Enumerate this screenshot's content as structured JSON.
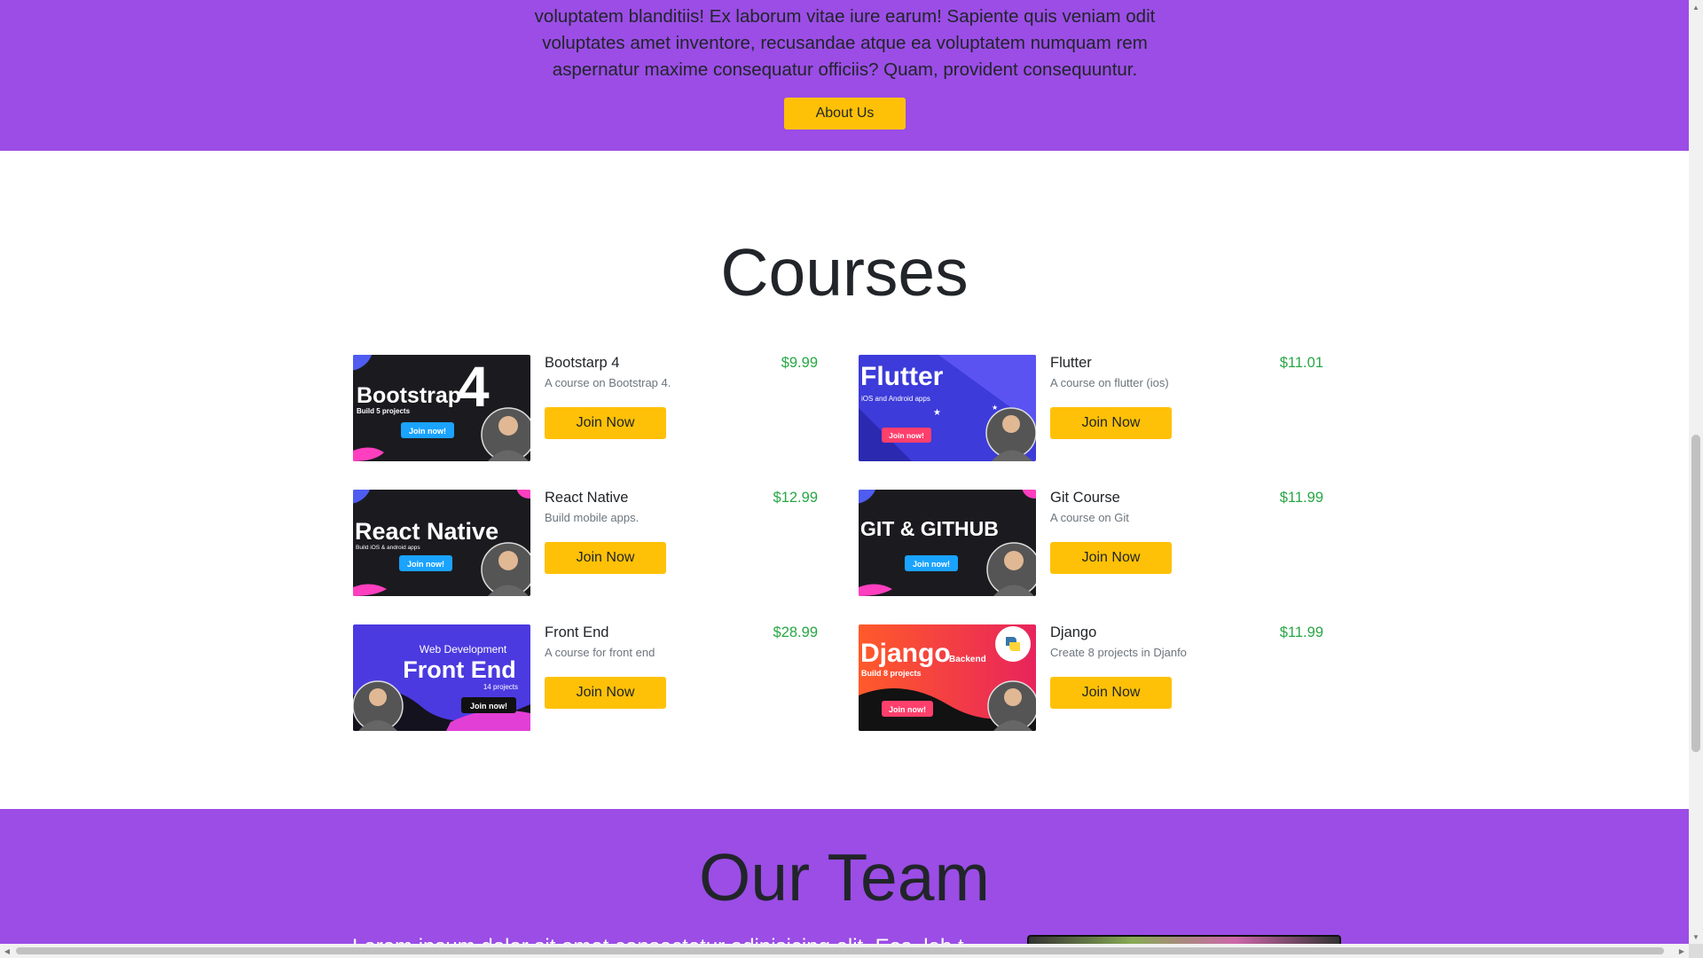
{
  "about": {
    "text": "voluptatem blanditiis! Ex laborum vitae iure earum! Sapiente quis veniam odit voluptates amet inventore, recusandae atque ea voluptatem numquam rem aspernatur maxime consequatur officiis? Quam, provident consequuntur.",
    "button_label": "About Us"
  },
  "courses": {
    "title": "Courses",
    "join_label": "Join Now",
    "items": [
      {
        "name": "Bootstarp 4",
        "description": "A course on Bootstrap 4.",
        "price": "$9.99",
        "thumb": {
          "title": "Bootstrap 4",
          "subtitle": "Build 5 projects",
          "badge": "Join now!",
          "bg": "#1b1b1f"
        }
      },
      {
        "name": "Flutter",
        "description": "A course on flutter (ios)",
        "price": "$11.01",
        "thumb": {
          "title": "Flutter",
          "subtitle": "iOS and Android apps",
          "badge": "Join now!",
          "bg": "#3d3bd9"
        }
      },
      {
        "name": "React Native",
        "description": "Build mobile apps.",
        "price": "$12.99",
        "thumb": {
          "title": "React Native",
          "subtitle": "Build iOS & android apps",
          "badge": "Join now!",
          "bg": "#1b1b1f"
        }
      },
      {
        "name": "Git Course",
        "description": "A course on Git",
        "price": "$11.99",
        "thumb": {
          "title": "GIT & GITHUB",
          "subtitle": "",
          "badge": "Join now!",
          "bg": "#1b1b1f"
        }
      },
      {
        "name": "Front End",
        "description": "A course for front end",
        "price": "$28.99",
        "thumb": {
          "title": "Front End",
          "subtitle": "Web Development",
          "extra": "14 projects",
          "badge": "Join now!",
          "bg": "#4b3ae0"
        }
      },
      {
        "name": "Django",
        "description": "Create 8 projects in Djanfo",
        "price": "$11.99",
        "thumb": {
          "title": "Django",
          "tag": "Backend",
          "subtitle": "Build 8 projects",
          "badge": "Join now!",
          "bg": "#f2453b"
        }
      }
    ]
  },
  "team": {
    "title": "Our Team",
    "text": "Lorem ipsum dolor sit amet consectetur adipisicing elit. Eos, lab t"
  },
  "colors": {
    "purple": "#9b4de6",
    "yellow": "#ffc107",
    "price_green": "#28a745"
  }
}
